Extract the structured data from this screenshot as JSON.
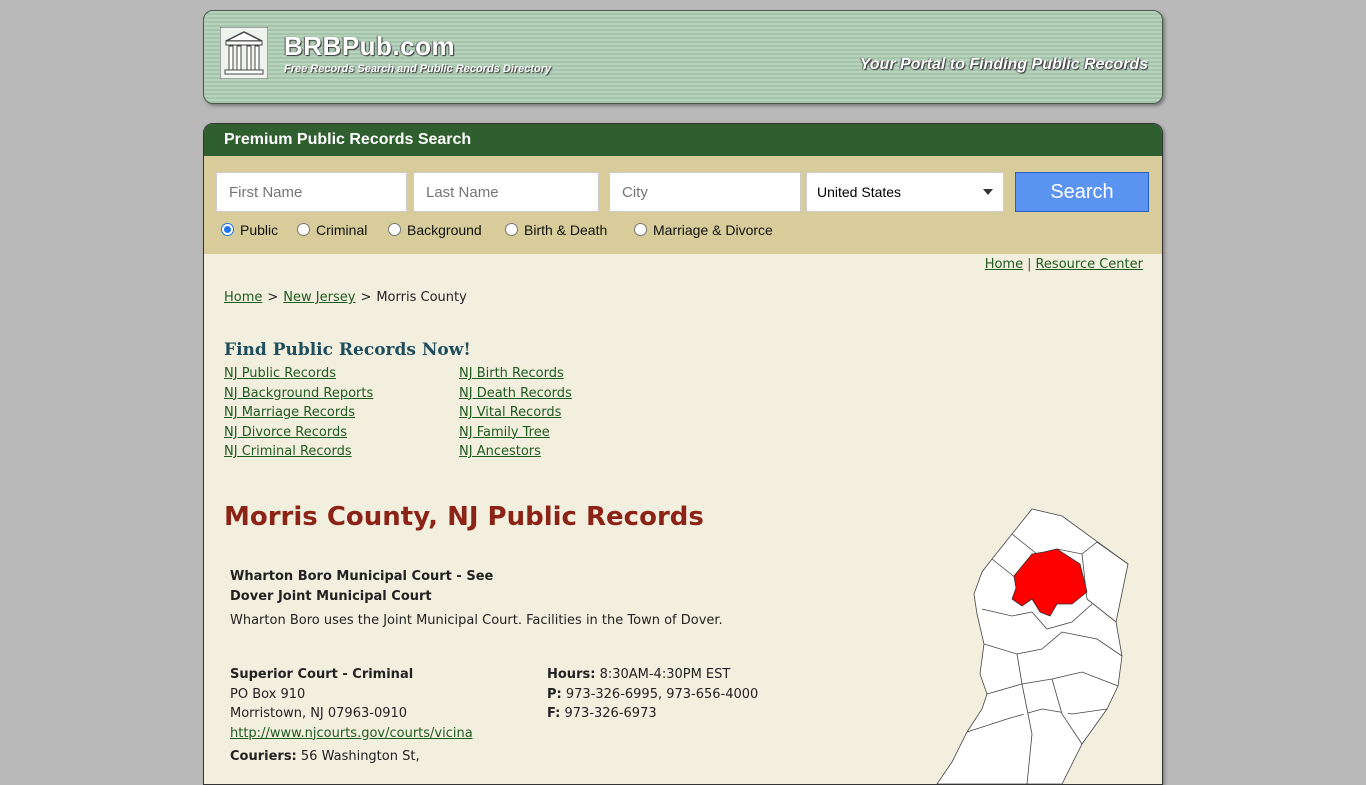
{
  "header": {
    "site_name": "BRBPub.com",
    "tagline": "Free Records Search and Public Records Directory",
    "portal": "Your Portal to Finding Public Records"
  },
  "search": {
    "title": "Premium Public Records Search",
    "first_name_placeholder": "First Name",
    "last_name_placeholder": "Last Name",
    "city_placeholder": "City",
    "country": "United States",
    "button": "Search",
    "radios": [
      {
        "label": "Public",
        "checked": true
      },
      {
        "label": "Criminal",
        "checked": false
      },
      {
        "label": "Background",
        "checked": false
      },
      {
        "label": "Birth & Death",
        "checked": false
      },
      {
        "label": "Marriage & Divorce",
        "checked": false
      }
    ]
  },
  "top_links": {
    "home": "Home",
    "sep": "|",
    "resource": "Resource Center"
  },
  "breadcrumb": {
    "home": "Home",
    "gt1": ">",
    "state": "New Jersey",
    "gt2": ">",
    "current": "Morris County"
  },
  "find": {
    "heading": "Find Public Records Now!",
    "left": [
      "NJ Public Records",
      "NJ Background Reports",
      "NJ Marriage Records",
      "NJ Divorce Records",
      "NJ Criminal Records"
    ],
    "right": [
      "NJ Birth Records",
      "NJ Death Records",
      "NJ Vital Records",
      "NJ Family Tree",
      "NJ Ancestors"
    ]
  },
  "page_title": "Morris County, NJ Public Records",
  "court1": {
    "name_line1": "Wharton Boro Municipal Court - See",
    "name_line2": "Dover Joint Municipal Court",
    "desc": "Wharton Boro uses the Joint Municipal Court. Facilities in the Town of Dover."
  },
  "court2": {
    "name": "Superior Court - Criminal",
    "address1": "PO Box 910",
    "address2": "Morristown, NJ 07963-0910",
    "url": "http://www.njcourts.gov/courts/vicina",
    "couriers_label": "Couriers:",
    "couriers": "56 Washington St,",
    "hours_label": "Hours:",
    "hours": "8:30AM-4:30PM EST",
    "phone_label": "P:",
    "phone": "973-326-6995, 973-656-4000",
    "fax_label": "F:",
    "fax": "973-326-6973"
  },
  "colors": {
    "header_green": "#2f5f2f",
    "search_bg": "#d7cc9a",
    "title_red": "#8b2316",
    "county_highlight": "#ff0000",
    "button_blue": "#5b93f0"
  }
}
